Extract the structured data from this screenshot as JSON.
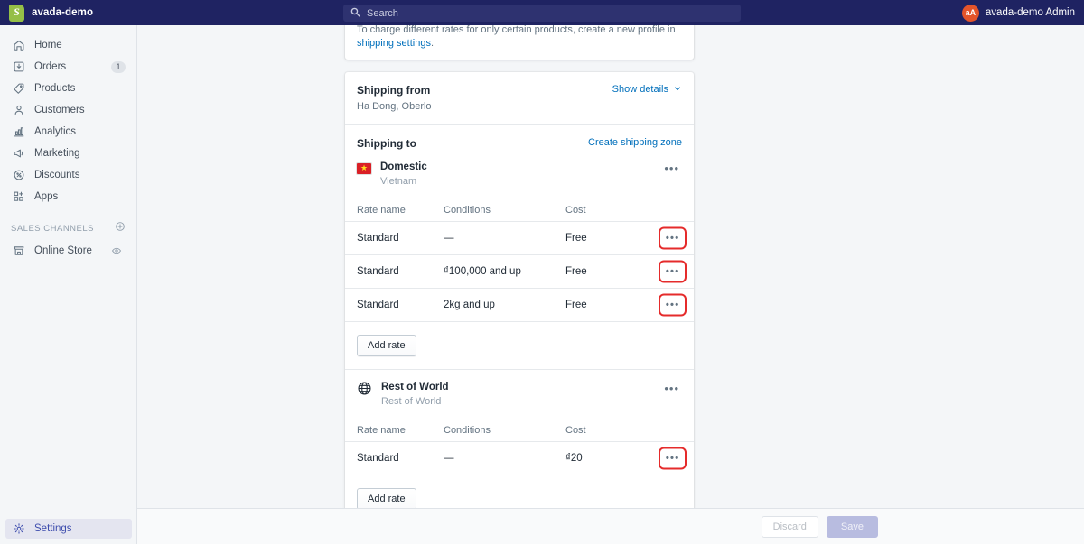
{
  "topbar": {
    "brand_name": "avada-demo",
    "logo_icon": "shopify-logo",
    "search": {
      "icon": "search-icon",
      "value": "",
      "placeholder": "Search"
    },
    "user": {
      "avatar_initials": "aA",
      "name": "avada-demo Admin"
    }
  },
  "sidebar": {
    "items": [
      {
        "label": "Home",
        "icon": "home-icon",
        "badge": ""
      },
      {
        "label": "Orders",
        "icon": "orders-icon",
        "badge": "1"
      },
      {
        "label": "Products",
        "icon": "products-tag-icon",
        "badge": ""
      },
      {
        "label": "Customers",
        "icon": "customers-person-icon",
        "badge": ""
      },
      {
        "label": "Analytics",
        "icon": "analytics-bars-icon",
        "badge": ""
      },
      {
        "label": "Marketing",
        "icon": "marketing-megaphone-icon",
        "badge": ""
      },
      {
        "label": "Discounts",
        "icon": "discounts-tag-percent-icon",
        "badge": ""
      },
      {
        "label": "Apps",
        "icon": "apps-grid-plus-icon",
        "badge": ""
      }
    ],
    "section": {
      "title": "SALES CHANNELS",
      "add_icon": "circle-plus-icon"
    },
    "channels": [
      {
        "label": "Online Store",
        "icon": "storefront-icon",
        "action_icon": "eye-icon"
      }
    ],
    "settings": {
      "label": "Settings",
      "icon": "gear-icon"
    }
  },
  "banner": {
    "text_before": "To charge different rates for only certain products, create a new profile in ",
    "link": "shipping settings",
    "text_after": "."
  },
  "shipping_from": {
    "title": "Shipping from",
    "address": "Ha Dong, Oberlo",
    "action": "Show details",
    "action_icon": "chevron-down-icon"
  },
  "shipping_to": {
    "title": "Shipping to",
    "action": "Create shipping zone",
    "columns": [
      "Rate name",
      "Conditions",
      "Cost"
    ],
    "menu_glyph": "•••",
    "add_rate_label": "Add rate",
    "zones": [
      {
        "name": "Domestic",
        "region": "Vietnam",
        "icon": "vietnam-flag-icon",
        "rates": [
          {
            "name": "Standard",
            "conditions": "—",
            "cost": "Free",
            "highlighted": true
          },
          {
            "name": "Standard",
            "conditions": "₫100,000 and up",
            "cost": "Free",
            "highlighted": true
          },
          {
            "name": "Standard",
            "conditions": "2kg and up",
            "cost": "Free",
            "highlighted": true
          }
        ]
      },
      {
        "name": "Rest of World",
        "region": "Rest of World",
        "icon": "globe-icon",
        "rates": [
          {
            "name": "Standard",
            "conditions": "—",
            "cost": "₫20",
            "highlighted": true
          }
        ]
      }
    ]
  },
  "footer": {
    "discard_label": "Discard",
    "save_label": "Save"
  },
  "colors": {
    "topbar_bg": "#1f2362",
    "accent_link": "#006fbb",
    "highlight_red": "#e52b2b",
    "avatar_bg": "#e4542a",
    "save_disabled_bg": "#b8bce0"
  }
}
